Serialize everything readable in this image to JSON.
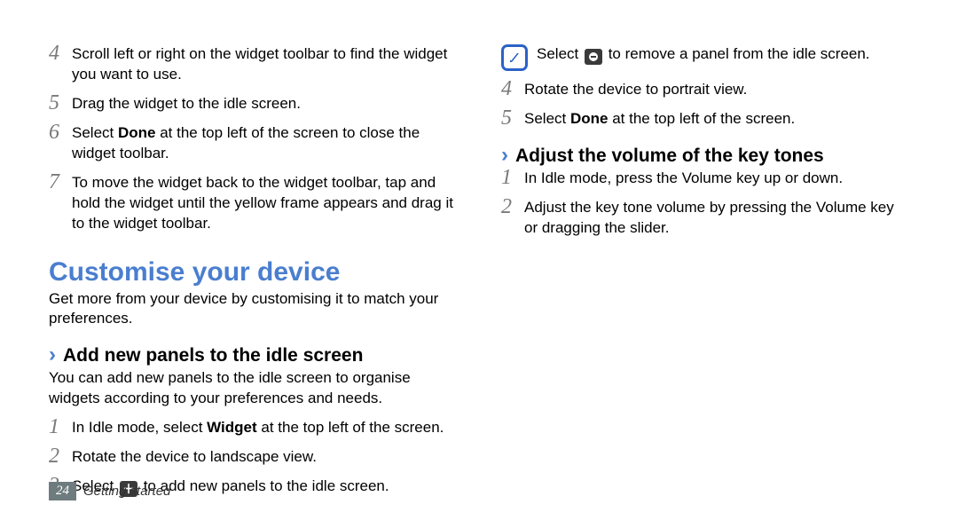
{
  "left": {
    "steps": [
      {
        "num": "4",
        "text_a": "Scroll left or right on the widget toolbar to find the widget you want to use."
      },
      {
        "num": "5",
        "text_a": "Drag the widget to the idle screen."
      },
      {
        "num": "6",
        "text_a": "Select ",
        "bold": "Done",
        "text_b": " at the top left of the screen to close the widget toolbar."
      },
      {
        "num": "7",
        "text_a": "To move the widget back to the widget toolbar, tap and hold the widget until the yellow frame appears and drag it to the widget toolbar."
      }
    ],
    "heading": "Customise your device",
    "intro": "Get more from your device by customising it to match your preferences.",
    "sub1": "Add new panels to the idle screen",
    "sub1intro": "You can add new panels to the idle screen to organise widgets according to your preferences and needs."
  },
  "right": {
    "steps_a": [
      {
        "num": "1",
        "text_a": "In Idle mode, select ",
        "bold": "Widget",
        "text_b": " at the top left of the screen."
      },
      {
        "num": "2",
        "text_a": "Rotate the device to landscape view."
      },
      {
        "num": "3",
        "text_a": "Select ",
        "icon": "plus",
        "text_b": " to add new panels to the idle screen."
      }
    ],
    "note": {
      "text_a": "Select ",
      "icon": "minus",
      "text_b": " to remove a panel from the idle screen."
    },
    "steps_b": [
      {
        "num": "4",
        "text_a": "Rotate the device to portrait view."
      },
      {
        "num": "5",
        "text_a": "Select ",
        "bold": "Done",
        "text_b": " at the top left of the screen."
      }
    ],
    "sub2": "Adjust the volume of the key tones",
    "steps_c": [
      {
        "num": "1",
        "text_a": "In Idle mode, press the Volume key up or down."
      },
      {
        "num": "2",
        "text_a": "Adjust the key tone volume by pressing the Volume key or dragging the slider."
      }
    ]
  },
  "footer": {
    "page": "24",
    "section": "Getting started"
  }
}
